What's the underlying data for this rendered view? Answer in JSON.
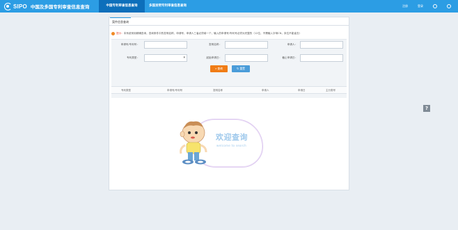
{
  "header": {
    "logo_text": "SIPO",
    "logo_title": "中国及多国专利审查信息查询",
    "tabs": [
      {
        "label": "中国专利审查信息查询",
        "active": true
      },
      {
        "label": "多国发明专利审查信息查询",
        "active": false
      }
    ],
    "links": [
      "注册",
      "登录"
    ],
    "accent_color": "#2c9de4",
    "active_tab_color": "#0d6fbb"
  },
  "panel": {
    "tab_label": "案件信息查询",
    "notice_label": "提示：",
    "notice_text": "本系统采用精确查询，查询条件中的发明名称、申请号、申请人三者必须填一个，输入的申请号/专利号必须为完整的（12位，不需输入字母CN，末位不能省去）"
  },
  "form": {
    "fields": [
      {
        "label": "申请号/专利号：",
        "value": ""
      },
      {
        "label": "发明名称：",
        "value": ""
      },
      {
        "label": "申请人：",
        "value": ""
      },
      {
        "label": "专利类型：",
        "value": ""
      },
      {
        "label": "起始申请日：",
        "value": ""
      },
      {
        "label": "截止申请日：",
        "value": ""
      }
    ],
    "search_button": "查询",
    "reset_button": "重置"
  },
  "table": {
    "columns": [
      "专利类型",
      "申请号/专利号",
      "发明名称",
      "申请人",
      "申请日",
      "主分类号"
    ]
  },
  "welcome": {
    "title": "欢迎查询",
    "subtitle": "welcome to search"
  },
  "help_label": "?"
}
